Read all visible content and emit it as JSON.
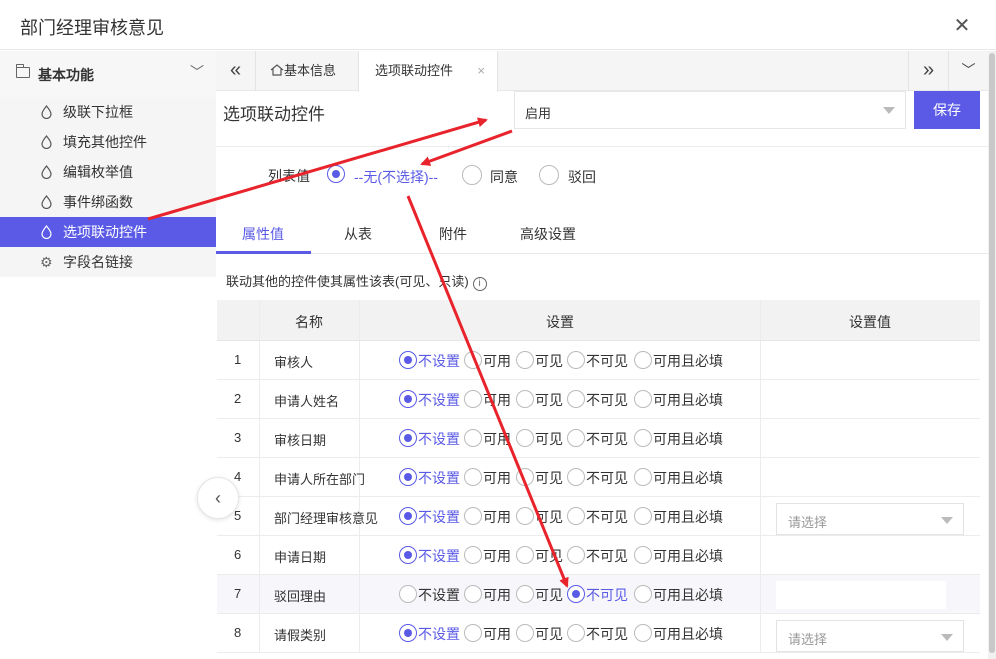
{
  "window": {
    "title": "部门经理审核意见"
  },
  "sidebar": {
    "group_label": "基本功能",
    "items": [
      {
        "label": "级联下拉框",
        "icon": "drop-icon",
        "active": false
      },
      {
        "label": "填充其他控件",
        "icon": "drop-icon",
        "active": false
      },
      {
        "label": "编辑枚举值",
        "icon": "drop-icon",
        "active": false
      },
      {
        "label": "事件绑函数",
        "icon": "drop-icon",
        "active": false
      },
      {
        "label": "选项联动控件",
        "icon": "drop-icon",
        "active": true
      },
      {
        "label": "字段名链接",
        "icon": "gear-icon",
        "active": false
      }
    ]
  },
  "tabs": [
    {
      "label": "基本信息",
      "icon": "home-icon"
    },
    {
      "label": "选项联动控件",
      "closable": true,
      "active": true
    }
  ],
  "header": {
    "heading": "选项联动控件",
    "select_value": "启用",
    "save_label": "保存"
  },
  "list_value": {
    "label": "列表值",
    "options": [
      {
        "label": "--无(不选择)--",
        "checked": true
      },
      {
        "label": "同意",
        "checked": false
      },
      {
        "label": "驳回",
        "checked": false
      }
    ]
  },
  "subtabs": [
    "属性值",
    "从表",
    "附件",
    "高级设置"
  ],
  "description": "联动其他的控件使其属性该表(可见、只读)",
  "grid": {
    "headers": [
      "名称",
      "设置",
      "设置值"
    ],
    "option_labels": [
      "不设置",
      "可用",
      "可见",
      "不可见",
      "可用且必填"
    ],
    "rows": [
      {
        "num": "1",
        "name": "审核人",
        "selected": 0,
        "value_type": "none",
        "value": ""
      },
      {
        "num": "2",
        "name": "申请人姓名",
        "selected": 0,
        "value_type": "none",
        "value": ""
      },
      {
        "num": "3",
        "name": "审核日期",
        "selected": 0,
        "value_type": "none",
        "value": ""
      },
      {
        "num": "4",
        "name": "申请人所在部门",
        "selected": 0,
        "value_type": "none",
        "value": ""
      },
      {
        "num": "5",
        "name": "部门经理审核意见",
        "selected": 0,
        "value_type": "select",
        "value": "请选择"
      },
      {
        "num": "6",
        "name": "申请日期",
        "selected": 0,
        "value_type": "none",
        "value": ""
      },
      {
        "num": "7",
        "name": "驳回理由",
        "selected": 3,
        "value_type": "input",
        "value": ""
      },
      {
        "num": "8",
        "name": "请假类别",
        "selected": 0,
        "value_type": "select",
        "value": "请选择"
      }
    ]
  },
  "colors": {
    "accent": "#5a5ae6",
    "annotation": "#e8232b"
  }
}
